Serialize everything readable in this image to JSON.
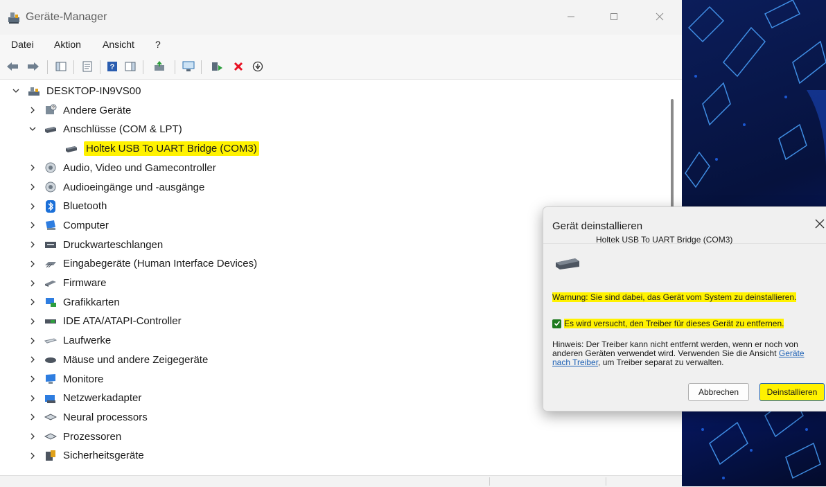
{
  "window": {
    "title": "Geräte-Manager"
  },
  "menu": [
    "Datei",
    "Aktion",
    "Ansicht",
    "?"
  ],
  "tree": {
    "root": "DESKTOP-IN9VS00",
    "items": [
      {
        "label": "Andere Geräte",
        "icon": "unknown-device-icon",
        "expanded": false
      },
      {
        "label": "Anschlüsse (COM & LPT)",
        "icon": "port-icon",
        "expanded": true
      },
      {
        "label": "Holtek USB To UART Bridge (COM3)",
        "icon": "port-icon",
        "child": true,
        "highlighted": true
      },
      {
        "label": "Audio, Video und Gamecontroller",
        "icon": "speaker-icon",
        "expanded": false
      },
      {
        "label": "Audioeingänge und -ausgänge",
        "icon": "speaker-icon",
        "expanded": false
      },
      {
        "label": "Bluetooth",
        "icon": "bluetooth-icon",
        "expanded": false
      },
      {
        "label": "Computer",
        "icon": "computer-icon",
        "expanded": false
      },
      {
        "label": "Druckwarteschlangen",
        "icon": "printer-icon",
        "expanded": false
      },
      {
        "label": "Eingabegeräte (Human Interface Devices)",
        "icon": "hid-icon",
        "expanded": false
      },
      {
        "label": "Firmware",
        "icon": "firmware-icon",
        "expanded": false
      },
      {
        "label": "Grafikkarten",
        "icon": "display-adapter-icon",
        "expanded": false
      },
      {
        "label": "IDE ATA/ATAPI-Controller",
        "icon": "ide-controller-icon",
        "expanded": false
      },
      {
        "label": "Laufwerke",
        "icon": "drive-icon",
        "expanded": false
      },
      {
        "label": "Mäuse und andere Zeigegeräte",
        "icon": "mouse-icon",
        "expanded": false
      },
      {
        "label": "Monitore",
        "icon": "monitor-icon",
        "expanded": false
      },
      {
        "label": "Netzwerkadapter",
        "icon": "network-adapter-icon",
        "expanded": false
      },
      {
        "label": "Neural processors",
        "icon": "chip-icon",
        "expanded": false
      },
      {
        "label": "Prozessoren",
        "icon": "chip-icon",
        "expanded": false
      },
      {
        "label": "Sicherheitsgeräte",
        "icon": "security-device-icon",
        "expanded": false
      }
    ]
  },
  "dialog": {
    "title": "Gerät deinstallieren",
    "device_name": "Holtek USB To UART Bridge (COM3)",
    "warning": "Warnung: Sie sind dabei, das Gerät vom System zu deinstallieren.",
    "checkbox_label": "Es wird versucht, den Treiber für dieses Gerät zu entfernen.",
    "checkbox_checked": true,
    "hint_prefix": "Hinweis: Der Treiber kann nicht entfernt werden, wenn er noch von anderen Geräten verwendet wird. Verwenden Sie die Ansicht ",
    "hint_link": "Geräte nach Treiber",
    "hint_suffix": ", um Treiber separat zu verwalten.",
    "cancel_label": "Abbrechen",
    "uninstall_label": "Deinstallieren"
  },
  "colors": {
    "highlight": "#fff200",
    "check": "#1e7a1e",
    "link": "#1a5fb4",
    "delete_icon": "#e81123"
  }
}
